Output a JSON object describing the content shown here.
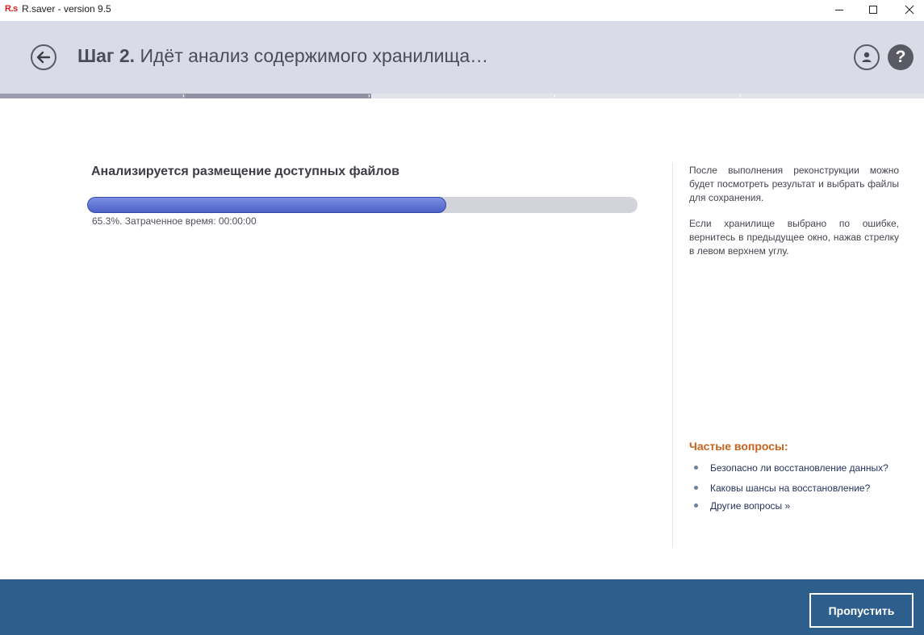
{
  "window": {
    "logo_text": "R.s",
    "title": "R.saver - version 9.5",
    "icons": {
      "minimize": "minimize-icon",
      "maximize": "maximize-icon",
      "close": "close-icon"
    }
  },
  "header": {
    "step_label": "Шаг 2.",
    "title_text": "Идёт анализ содержимого хранилища…",
    "icons": {
      "back": "arrow-left-icon",
      "account": "user-icon",
      "help": "question-icon"
    },
    "help_glyph": "?"
  },
  "step_indicator": {
    "total_steps": 4,
    "completed_steps": 2,
    "colors": {
      "completed": "#9a9cae",
      "active": "#8f91a3",
      "pending": "#e2e4ec"
    }
  },
  "main": {
    "heading": "Анализируется размещение доступных файлов",
    "progress": {
      "percent": 65.3,
      "fill_color": "#5a6fd1",
      "track_color": "#d2d3db"
    },
    "status_text": "65.3%. Затраченное время: 00:00:00"
  },
  "side": {
    "paragraph1": "После выполнения реконструкции можно будет посмотреть результат и выбрать файлы для сохранения.",
    "paragraph2": "Если хранилище выбрано по ошибке, вернитесь в предыдущее окно, нажав стрелку в левом верхнем углу.",
    "faq_title": "Частые вопросы:",
    "faq_items": [
      "Безопасно ли восстановление данных?",
      "Каковы шансы на восстановление?",
      "Другие вопросы »"
    ]
  },
  "footer": {
    "skip_label": "Пропустить",
    "background_color": "#2e5f8c"
  },
  "colors": {
    "header_bg": "#d9dce7",
    "faq_title": "#c8621c"
  }
}
